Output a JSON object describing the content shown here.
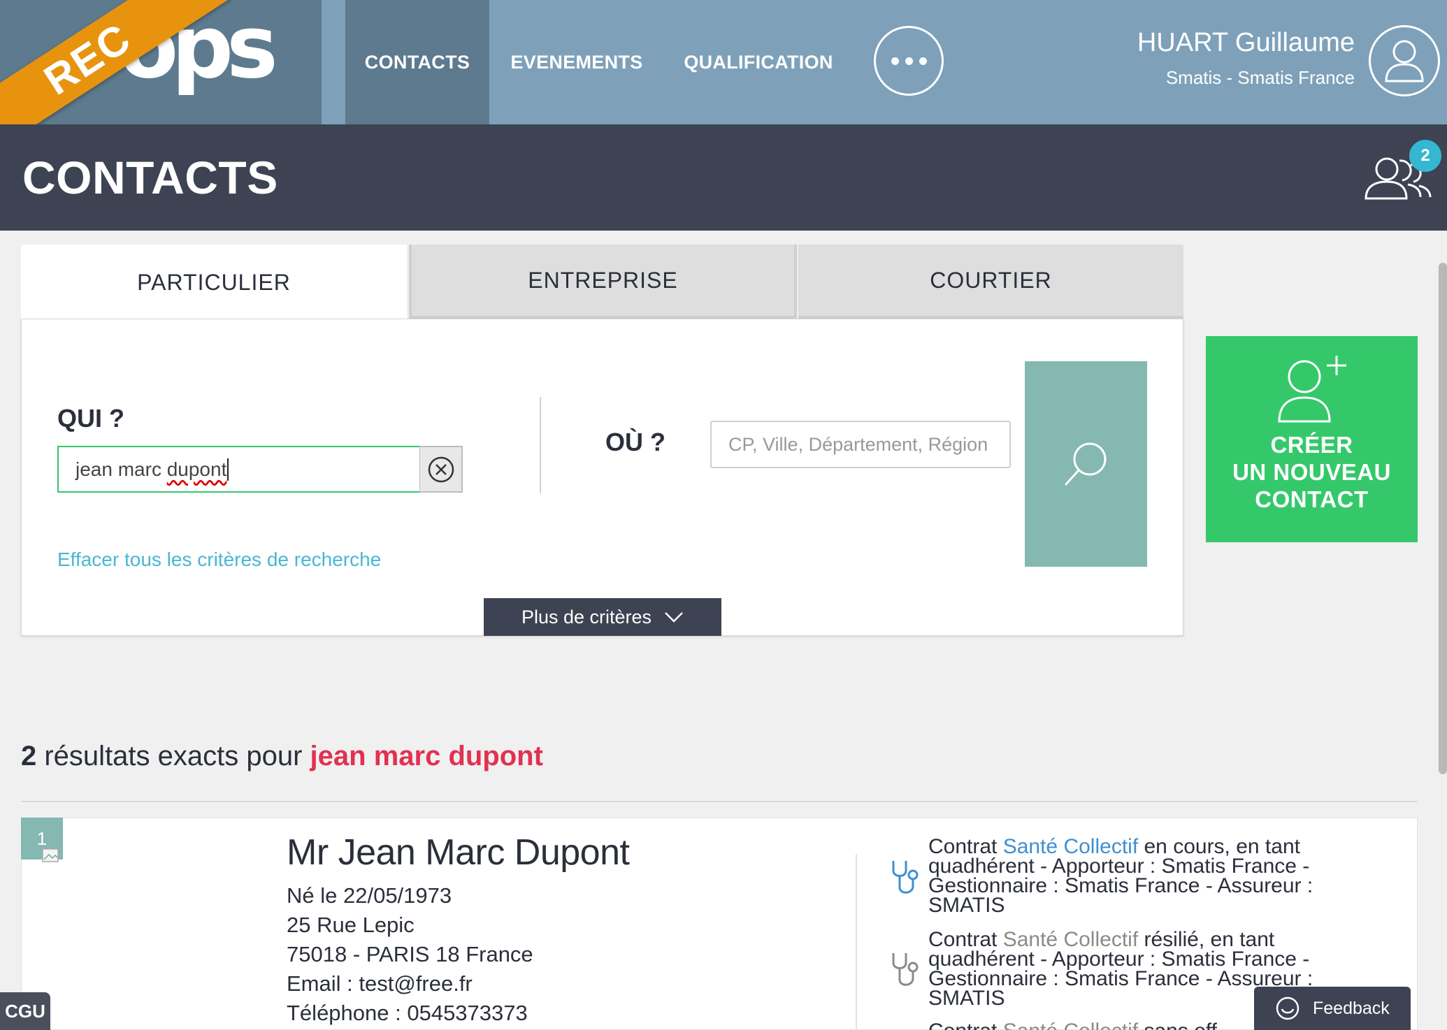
{
  "app": {
    "logo_text": "ops",
    "env_ribbon": "REC"
  },
  "nav": {
    "items": [
      {
        "label": "CONTACTS",
        "active": true
      },
      {
        "label": "EVENEMENTS",
        "active": false
      },
      {
        "label": "QUALIFICATION",
        "active": false
      }
    ],
    "more_icon": "ellipsis-icon"
  },
  "user": {
    "name": "HUART Guillaume",
    "organization": "Smatis - Smatis France",
    "avatar_icon": "user-icon"
  },
  "header": {
    "title": "CONTACTS",
    "group_icon": "group-users-icon",
    "notification_count": "2"
  },
  "tabs": [
    {
      "label": "PARTICULIER",
      "active": true
    },
    {
      "label": "ENTREPRISE",
      "active": false
    },
    {
      "label": "COURTIER",
      "active": false
    }
  ],
  "search": {
    "qui_label": "QUI ?",
    "qui_value_prefix": "jean marc ",
    "qui_value_misspelled": "dupont",
    "ou_label": "OÙ ?",
    "ou_placeholder": "CP, Ville, Département, Région",
    "clear_link": "Effacer tous les critères de recherche",
    "more_criteria": "Plus de critères"
  },
  "create_contact": {
    "line1": "CRÉER",
    "line2": "UN NOUVEAU",
    "line3": "CONTACT"
  },
  "results": {
    "count": "2",
    "text": " résultats exacts pour ",
    "query": "jean marc dupont",
    "items": [
      {
        "index": "1",
        "name": "Mr Jean Marc Dupont",
        "birth": "Né le 22/05/1973",
        "address1": "25 Rue Lepic",
        "address2": "75018 - PARIS 18 France",
        "email": "Email : test@free.fr",
        "phone": "Téléphone : 0545373373",
        "contracts": [
          {
            "prefix": "Contrat ",
            "kind": "Santé Collectif",
            "status_text": " en cours, en tant quadhérent - Apporteur : Smatis France - Gestionnaire : Smatis France - Assureur : SMATIS",
            "status": "active"
          },
          {
            "prefix": "Contrat ",
            "kind": "Santé Collectif",
            "status_text": " résilié, en tant quadhérent - Apporteur : Smatis France - Gestionnaire : Smatis France - Assureur : SMATIS",
            "status": "resilie"
          },
          {
            "prefix": "Contrat ",
            "kind": "Santé Collectif",
            "status_text": " sans eff",
            "status": "resilie"
          }
        ]
      }
    ]
  },
  "footer": {
    "cgu": "CGU",
    "feedback": "Feedback"
  },
  "colors": {
    "topbar": "#7ea1b9",
    "header": "#3d4352",
    "accent_green": "#35c86b",
    "search_teal": "#84b8b1",
    "query_red": "#e2314f",
    "link_blue": "#4bb6d3",
    "ribbon_orange": "#e8930e"
  }
}
